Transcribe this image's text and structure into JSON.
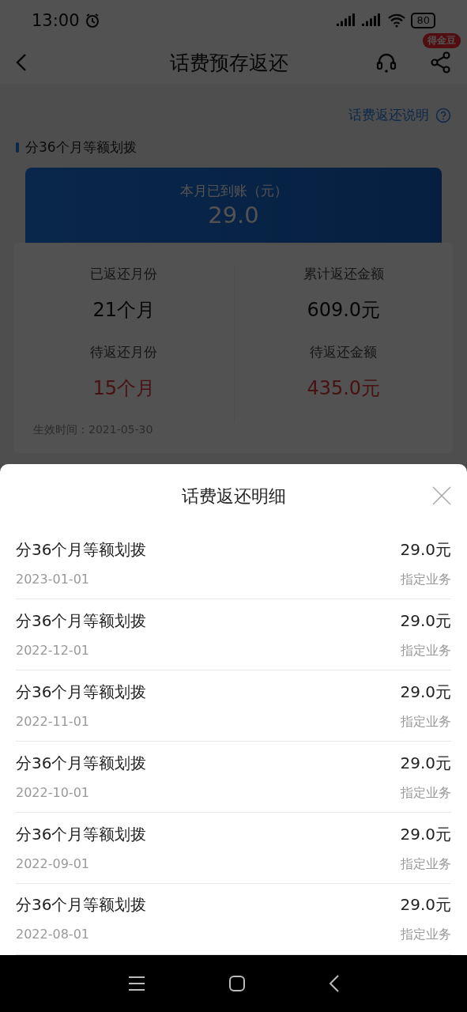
{
  "status_bar": {
    "time": "13:00",
    "battery": "80"
  },
  "header": {
    "title": "话费预存返还",
    "badge": "得金豆"
  },
  "explain_link": "话费返还说明",
  "section_title": "分36个月等额划拨",
  "summary": {
    "label": "本月已到账（元）",
    "amount": "29.0"
  },
  "stats": [
    {
      "label": "已返还月份",
      "value": "21个月",
      "highlight": false
    },
    {
      "label": "累计返还金额",
      "value": "609.0元",
      "highlight": false
    },
    {
      "label": "待返还月份",
      "value": "15个月",
      "highlight": true
    },
    {
      "label": "待返还金额",
      "value": "435.0元",
      "highlight": true
    }
  ],
  "effective": "生效时间：2021-05-30",
  "sheet": {
    "title": "话费返还明细",
    "items": [
      {
        "title": "分36个月等额划拨",
        "amount": "29.0元",
        "date": "2023-01-01",
        "type": "指定业务"
      },
      {
        "title": "分36个月等额划拨",
        "amount": "29.0元",
        "date": "2022-12-01",
        "type": "指定业务"
      },
      {
        "title": "分36个月等额划拨",
        "amount": "29.0元",
        "date": "2022-11-01",
        "type": "指定业务"
      },
      {
        "title": "分36个月等额划拨",
        "amount": "29.0元",
        "date": "2022-10-01",
        "type": "指定业务"
      },
      {
        "title": "分36个月等额划拨",
        "amount": "29.0元",
        "date": "2022-09-01",
        "type": "指定业务"
      },
      {
        "title": "分36个月等额划拨",
        "amount": "29.0元",
        "date": "2022-08-01",
        "type": "指定业务"
      }
    ]
  }
}
